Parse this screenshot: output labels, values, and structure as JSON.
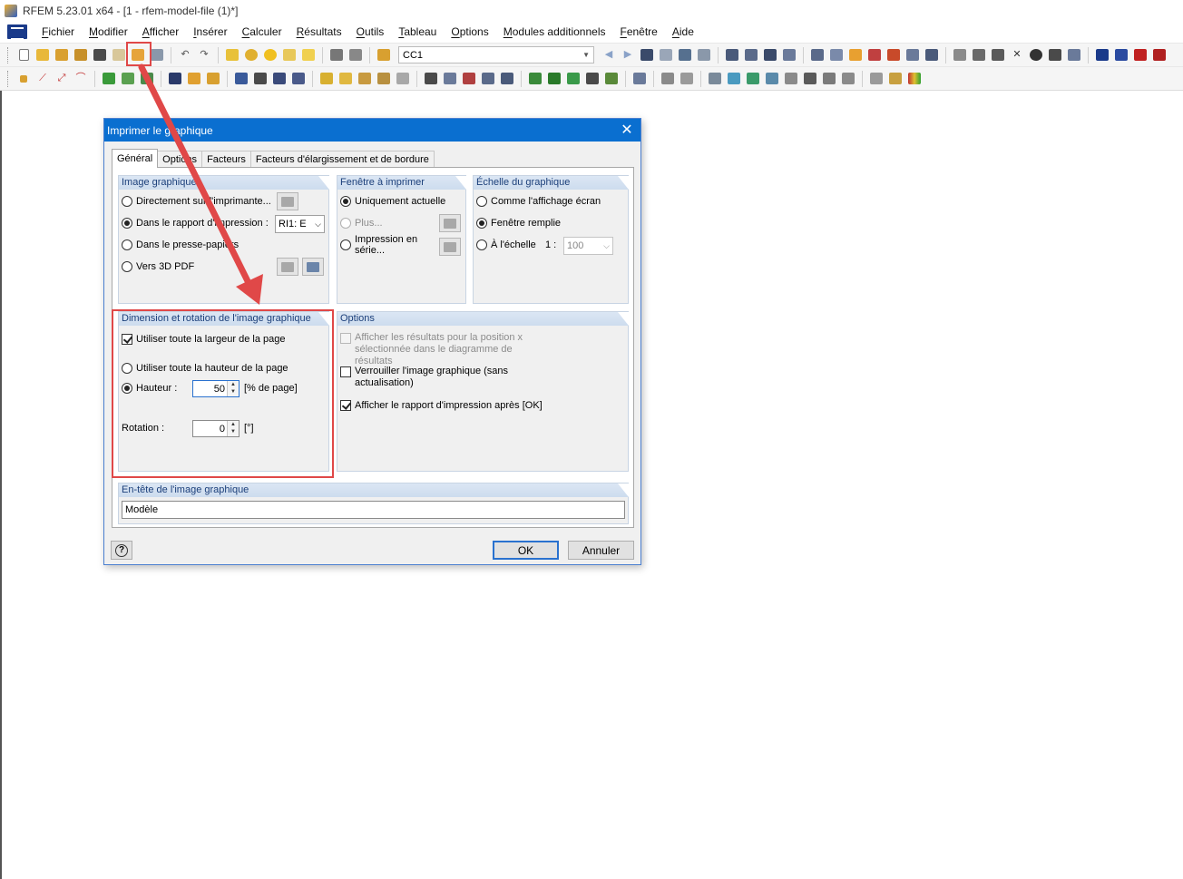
{
  "window": {
    "title": "RFEM 5.23.01 x64 - [1 - rfem-model-file (1)*]"
  },
  "menu": [
    "Fichier",
    "Modifier",
    "Afficher",
    "Insérer",
    "Calculer",
    "Résultats",
    "Outils",
    "Tableau",
    "Options",
    "Modules additionnels",
    "Fenêtre",
    "Aide"
  ],
  "toolbar": {
    "load_case": "CC1"
  },
  "dialog": {
    "title": "Imprimer le graphique",
    "tabs": [
      "Général",
      "Options",
      "Facteurs",
      "Facteurs d'élargissement et de bordure"
    ],
    "image_group": {
      "title": "Image graphique",
      "opt_printer": "Directement sur l'imprimante...",
      "opt_report": "Dans le rapport d'impression :",
      "report_value": "RI1: E",
      "opt_clipboard": "Dans le presse-papiers",
      "opt_3dpdf": "Vers 3D PDF"
    },
    "window_group": {
      "title": "Fenêtre à imprimer",
      "opt_current": "Uniquement actuelle",
      "opt_more": "Plus...",
      "opt_serial": "Impression en série..."
    },
    "scale_group": {
      "title": "Échelle du graphique",
      "opt_screen": "Comme l'affichage écran",
      "opt_fill": "Fenêtre remplie",
      "opt_scale": "À l'échelle",
      "scale_prefix": "1 :",
      "scale_value": "100"
    },
    "size_group": {
      "title": "Dimension et rotation de l'image graphique",
      "chk_full_width": "Utiliser toute la largeur de la page",
      "opt_full_height": "Utiliser toute la hauteur de la page",
      "opt_height": "Hauteur :",
      "height_value": "50",
      "height_unit": "[% de page]",
      "rotation_label": "Rotation :",
      "rotation_value": "0",
      "rotation_unit": "[°]"
    },
    "options_group": {
      "title": "Options",
      "chk_results_x": "Afficher les résultats pour la position x sélectionnée dans le diagramme de résultats",
      "chk_lock": "Verrouiller l'image graphique (sans actualisation)",
      "chk_show_report": "Afficher le rapport d'impression après [OK]"
    },
    "header_group": {
      "title": "En-tête de l'image graphique",
      "value": "Modèle"
    },
    "ok_label": "OK",
    "cancel_label": "Annuler"
  },
  "colors": {
    "accent": "#0a6fd0",
    "highlight": "#e04848"
  }
}
